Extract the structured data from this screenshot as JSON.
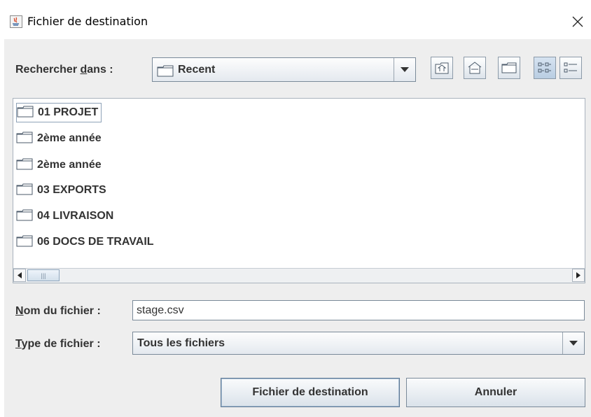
{
  "window": {
    "title": "Fichier de destination",
    "close_glyph": "✕"
  },
  "lookin": {
    "label_prefix": "Rechercher ",
    "label_mnemonic": "d",
    "label_suffix": "ans :",
    "value": "Recent"
  },
  "toolbar": {
    "buttons": [
      "up-one-level-icon",
      "home-icon",
      "new-folder-icon",
      "list-view-icon",
      "details-view-icon"
    ]
  },
  "files": [
    {
      "name": "01 PROJET",
      "selected": true
    },
    {
      "name": "2ème année"
    },
    {
      "name": "2ème année"
    },
    {
      "name": "03 EXPORTS"
    },
    {
      "name": "04 LIVRAISON"
    },
    {
      "name": "06 DOCS DE TRAVAIL"
    }
  ],
  "filename": {
    "label_mnemonic": "N",
    "label_rest": "om du fichier :",
    "value": "stage.csv"
  },
  "filetype": {
    "label_mnemonic": "T",
    "label_rest": "ype de fichier :",
    "value": "Tous les fichiers"
  },
  "buttons": {
    "save": "Fichier de destination",
    "cancel": "Annuler"
  },
  "scrollbar": {
    "thumb_grip": "|||"
  }
}
